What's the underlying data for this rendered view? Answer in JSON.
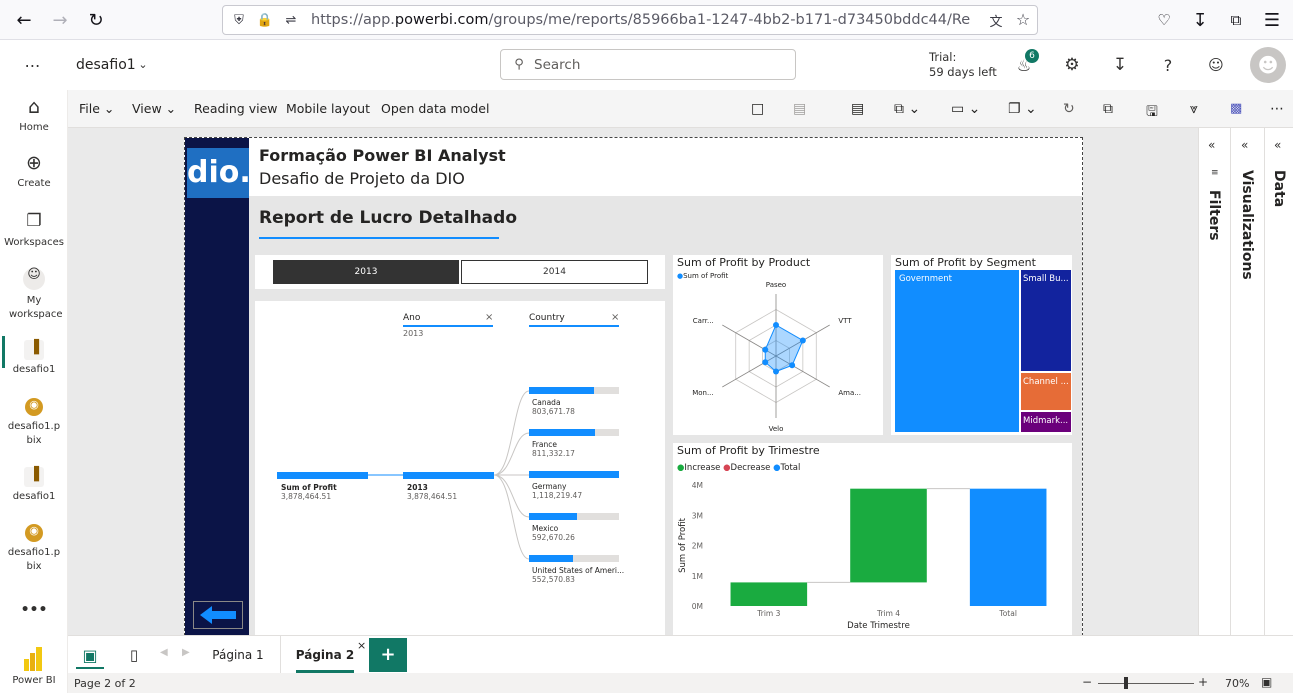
{
  "browser": {
    "url_prefix": "https://app.",
    "url_domain": "powerbi.com",
    "url_rest": "/groups/me/reports/85966ba1-1247-4bb2-b171-d73450bddc44/Repor"
  },
  "header": {
    "report_name": "desafio1",
    "search_placeholder": "Search",
    "trial_line1": "Trial:",
    "trial_line2": "59 days left",
    "notification_count": "6"
  },
  "leftnav": {
    "items": [
      {
        "label": "Home",
        "icon": "home-icon"
      },
      {
        "label": "Create",
        "icon": "plus-circle-icon"
      },
      {
        "label": "Workspaces",
        "icon": "workspaces-icon"
      },
      {
        "label": "My workspace",
        "icon": "person-icon"
      },
      {
        "label": "desafio1",
        "icon": "report-icon"
      },
      {
        "label": "desafio1.pbix",
        "icon": "dataset-icon"
      },
      {
        "label": "desafio1",
        "icon": "report-icon"
      },
      {
        "label": "desafio1.pbix",
        "icon": "dataset-icon"
      }
    ],
    "more": "•••",
    "powerbi_label": "Power BI"
  },
  "ribbon": {
    "file": "File",
    "view": "View",
    "reading_view": "Reading view",
    "mobile_layout": "Mobile layout",
    "open_data_model": "Open data model"
  },
  "report": {
    "logo_text": "dio.",
    "title": "Formação Power BI Analyst",
    "subtitle": "Desafio de Projeto da DIO",
    "heading": "Report de Lucro Detalhado",
    "slicer_years": [
      "2013",
      "2014"
    ],
    "slicer_selected": "2013"
  },
  "decomposition": {
    "col1_header": "Ano",
    "col1_value": "2013",
    "col2_header": "Country",
    "root_label": "Sum of Profit",
    "root_value": "3,878,464.51",
    "year_label": "2013",
    "year_value": "3,878,464.51",
    "countries": [
      {
        "name": "Canada",
        "value": "803,671.78",
        "fraction": 0.72
      },
      {
        "name": "France",
        "value": "811,332.17",
        "fraction": 0.73
      },
      {
        "name": "Germany",
        "value": "1,118,219.47",
        "fraction": 1.0
      },
      {
        "name": "Mexico",
        "value": "592,670.26",
        "fraction": 0.53
      },
      {
        "name": "United States of Ameri...",
        "value": "552,570.83",
        "fraction": 0.49
      }
    ]
  },
  "radar": {
    "title": "Sum of Profit by Product",
    "legend": "Sum of Profit",
    "axes": [
      "Paseo",
      "VTT",
      "Ama...",
      "Velo",
      "Mon...",
      "Carr..."
    ]
  },
  "treemap": {
    "title": "Sum of Profit by Segment",
    "tiles": [
      "Government",
      "Small Bu...",
      "Channel ...",
      "Midmark..."
    ]
  },
  "chart_data": {
    "type": "bar",
    "title": "Sum of Profit by Trimestre",
    "legend": [
      "Increase",
      "Decrease",
      "Total"
    ],
    "categories": [
      "Trim 3",
      "Trim 4",
      "Total"
    ],
    "xlabel": "Date Trimestre",
    "ylabel": "Sum of Profit",
    "yticks": [
      "0M",
      "1M",
      "2M",
      "3M",
      "4M"
    ],
    "ylim": [
      0,
      4000000
    ],
    "waterfall": [
      {
        "category": "Trim 3",
        "start": 0,
        "end": 780000,
        "kind": "increase"
      },
      {
        "category": "Trim 4",
        "start": 780000,
        "end": 3878464.51,
        "kind": "increase"
      },
      {
        "category": "Total",
        "start": 0,
        "end": 3878464.51,
        "kind": "total"
      }
    ],
    "colors": {
      "increase": "#1aab40",
      "decrease": "#d64554",
      "total": "#118dff"
    }
  },
  "panes": {
    "filters": "Filters",
    "visualizations": "Visualizations",
    "data": "Data"
  },
  "tabs": {
    "page1": "Página 1",
    "page2": "Página 2",
    "add": "+"
  },
  "status": {
    "page_info": "Page 2 of 2",
    "zoom": "70%"
  }
}
